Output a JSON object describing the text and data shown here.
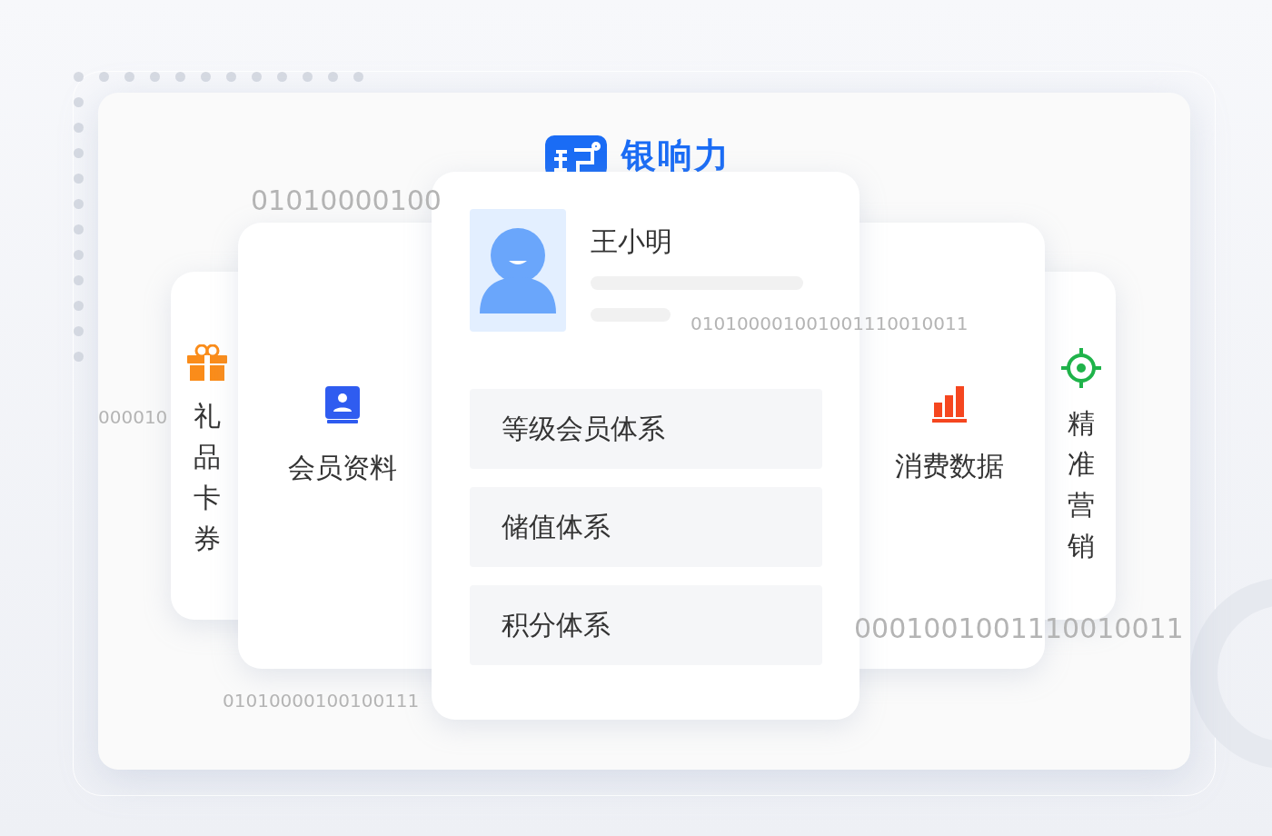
{
  "brand": {
    "name": "银响力"
  },
  "binary_texts": [
    {
      "text": "01010000100",
      "kind": "large"
    },
    {
      "text": "010100001001001110010011",
      "kind": "small"
    },
    {
      "text": "000010",
      "kind": "small"
    },
    {
      "text": "0001001001110010011",
      "kind": "large"
    },
    {
      "text": "01010000100100111",
      "kind": "small"
    }
  ],
  "profile": {
    "name": "王小明"
  },
  "features": [
    "等级会员体系",
    "储值体系",
    "积分体系"
  ],
  "side_cards": [
    {
      "label": "礼品卡券",
      "kind": "gift",
      "vertical": true,
      "color": "#fa8c1a"
    },
    {
      "label": "会员资料",
      "kind": "contact",
      "vertical": false,
      "color": "#2f5cf0"
    },
    {
      "label": "消费数据",
      "kind": "chart",
      "vertical": false,
      "color": "#f5461f"
    },
    {
      "label": "精准营销",
      "kind": "target",
      "vertical": true,
      "color": "#1fb34a"
    }
  ]
}
